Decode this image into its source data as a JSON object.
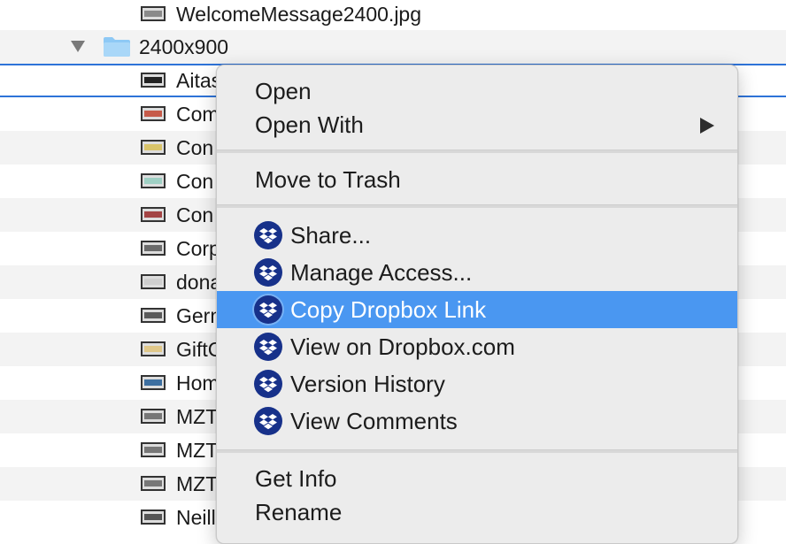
{
  "file_list": {
    "rows": [
      {
        "name": "WelcomeMessage2400.jpg",
        "kind": "file"
      },
      {
        "name": "2400x900",
        "kind": "folder"
      },
      {
        "name": "Aitas",
        "kind": "file"
      },
      {
        "name": "Com",
        "kind": "file"
      },
      {
        "name": "Con",
        "kind": "file"
      },
      {
        "name": "Con",
        "kind": "file"
      },
      {
        "name": "Con",
        "kind": "file"
      },
      {
        "name": "Corp",
        "kind": "file"
      },
      {
        "name": "dona",
        "kind": "file"
      },
      {
        "name": "Germ",
        "kind": "file"
      },
      {
        "name": "GiftC",
        "kind": "file"
      },
      {
        "name": "Hom",
        "kind": "file"
      },
      {
        "name": "MZT",
        "kind": "file"
      },
      {
        "name": "MZT",
        "kind": "file"
      },
      {
        "name": "MZT",
        "kind": "file"
      },
      {
        "name": "Neill",
        "kind": "file"
      }
    ]
  },
  "context_menu": {
    "open": "Open",
    "open_with": "Open With",
    "move_to_trash": "Move to Trash",
    "dropbox_items": {
      "share": "Share...",
      "manage_access": "Manage Access...",
      "copy_link": "Copy Dropbox Link",
      "view_on_web": "View on Dropbox.com",
      "version_history": "Version History",
      "view_comments": "View Comments"
    },
    "get_info": "Get Info",
    "rename": "Rename",
    "highlighted_item": "Copy Dropbox Link"
  },
  "icons": {
    "folder": "folder-icon",
    "image_file": "image-file-icon",
    "disclosure": "disclosure-triangle-icon",
    "dropbox": "dropbox-icon",
    "submenu": "submenu-arrow-icon"
  },
  "colors": {
    "highlight": "#4a97f1",
    "dropbox_badge": "#17318a",
    "selection_outline": "#2e73d8",
    "folder": "#8ec9f5"
  }
}
